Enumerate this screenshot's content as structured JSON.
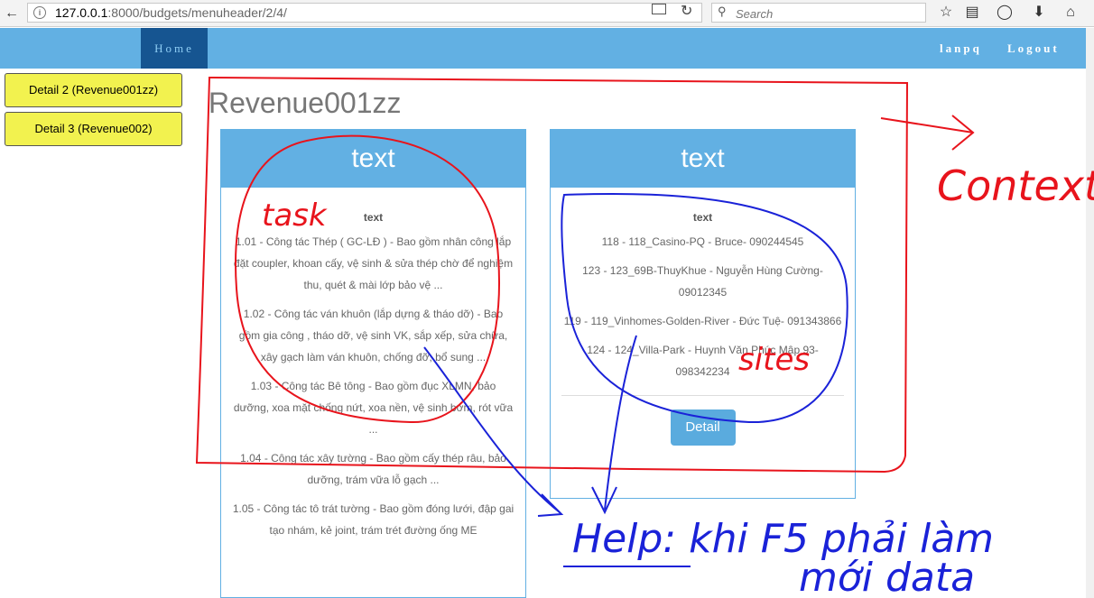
{
  "browser": {
    "url_host": "127.0.0.1",
    "url_path": ":8000/budgets/menuheader/2/4/",
    "search_placeholder": "Search"
  },
  "header": {
    "home_label": "Home",
    "user_label": "lanpq",
    "logout_label": "Logout"
  },
  "sidebar": {
    "buttons": [
      {
        "label": "Detail 2 (Revenue001zz)"
      },
      {
        "label": "Detail 3 (Revenue002)"
      }
    ]
  },
  "page": {
    "title": "Revenue001zz"
  },
  "tasks_panel": {
    "heading": "text",
    "subheading": "text",
    "items": [
      "1.01 - Công tác Thép ( GC-LĐ ) - Bao gồm nhân công lắp đặt coupler, khoan cấy, vệ sinh & sửa thép chờ để nghiệm thu, quét & mài lớp bảo vệ ...",
      "1.02 - Công tác ván khuôn (lắp dựng & tháo dỡ) - Bao gồm gia công , tháo dỡ, vệ sinh VK, sắp xếp, sửa chữa, xây gạch làm ván khuôn, chống đỡ, bổ sung ...",
      "1.03 - Công tác Bê tông - Bao gồm đục XLMN, bảo dưỡng, xoa mặt chống nứt, xoa nền, vệ sinh bơm, rót vữa ...",
      "1.04 - Công tác xây tường - Bao gồm cấy thép râu, bảo dưỡng, trám vữa lỗ gạch ...",
      "1.05 - Công tác tô trát tường - Bao gồm đóng lưới, đập gai tạo nhám, kẻ joint, trám trét đường ống ME"
    ]
  },
  "sites_panel": {
    "heading": "text",
    "subheading": "text",
    "items": [
      "118 - 118_Casino-PQ - Bruce- 090244545",
      "123 - 123_69B-ThuyKhue - Nguyễn Hùng Cường- 09012345",
      "119 - 119_Vinhomes-Golden-River - Đức Tuệ- 091343866",
      "124 - 124_Villa-Park - Huynh Văn Phúc Mập 93- 098342234"
    ],
    "detail_label": "Detail"
  },
  "annotations": {
    "context": "Context",
    "task": "task",
    "sites": "sites",
    "help_line1": "Help: khi F5 phải làm",
    "help_line2": "mới data"
  },
  "colors": {
    "header_bg": "#62b0e3",
    "nav_active_bg": "#165591",
    "side_button_bg": "#f2f24f",
    "red_ink": "#e8141c",
    "blue_ink": "#1a22d8"
  }
}
